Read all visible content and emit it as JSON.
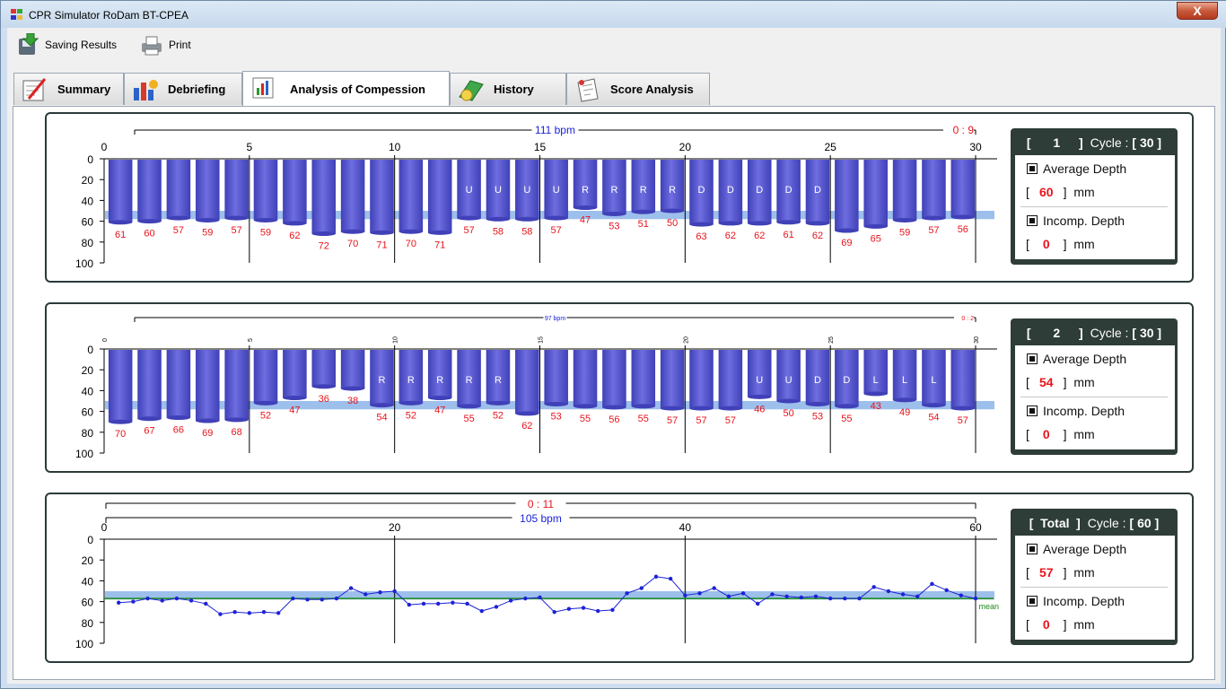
{
  "window": {
    "title": "CPR Simulator RoDam BT-CPEA",
    "close_label": "X"
  },
  "toolbar": {
    "save_label": "Saving Results",
    "print_label": "Print"
  },
  "tabs": [
    {
      "label": "Summary",
      "icon": "summary-icon"
    },
    {
      "label": "Debriefing",
      "icon": "debriefing-icon"
    },
    {
      "label": "Analysis of Compession",
      "icon": "bar-chart-icon",
      "active": true
    },
    {
      "label": "History",
      "icon": "history-icon"
    },
    {
      "label": "Score Analysis",
      "icon": "score-icon"
    }
  ],
  "colors": {
    "bar": "#6e6ee0",
    "bar_dark": "#4040b8",
    "band": "#8cb4e8",
    "value_text": "#e8141c",
    "bpm_text": "#1c22d6",
    "mean_line": "#1a8a1a"
  },
  "chart_data": [
    {
      "type": "bar",
      "title": "111 bpm",
      "time_label": "0 : 9",
      "x_ticks": [
        "0",
        "5",
        "10",
        "15",
        "20",
        "25",
        "30"
      ],
      "y_ticks": [
        "0",
        "20",
        "40",
        "60",
        "80",
        "100"
      ],
      "ylim": [
        0,
        100
      ],
      "target_band": [
        50,
        58
      ],
      "values": [
        61,
        60,
        57,
        59,
        57,
        59,
        62,
        72,
        70,
        71,
        70,
        71,
        57,
        58,
        58,
        57,
        47,
        53,
        51,
        50,
        63,
        62,
        62,
        61,
        62,
        69,
        65,
        59,
        57,
        56
      ],
      "labels": [
        "",
        "",
        "",
        "",
        "",
        "",
        "",
        "",
        "",
        "",
        "",
        "",
        "U",
        "U",
        "U",
        "U",
        "R",
        "R",
        "R",
        "R",
        "D",
        "D",
        "D",
        "D",
        "D",
        "",
        "",
        "",
        "",
        ""
      ]
    },
    {
      "type": "bar",
      "title": "97 bpm",
      "time_label": "0 : 2",
      "x_ticks": [
        "0",
        "5",
        "10",
        "15",
        "20",
        "25",
        "30"
      ],
      "y_ticks": [
        "0",
        "20",
        "40",
        "60",
        "80",
        "100"
      ],
      "ylim": [
        0,
        100
      ],
      "target_band": [
        50,
        58
      ],
      "values": [
        70,
        67,
        66,
        69,
        68,
        52,
        47,
        36,
        38,
        54,
        52,
        47,
        55,
        52,
        62,
        53,
        55,
        56,
        55,
        57,
        57,
        57,
        46,
        50,
        53,
        55,
        43,
        49,
        54,
        57
      ],
      "labels": [
        "",
        "",
        "",
        "",
        "",
        "",
        "",
        "",
        "",
        "R",
        "R",
        "R",
        "R",
        "R",
        "",
        "",
        "",
        "",
        "",
        "",
        "",
        "",
        "U",
        "U",
        "D",
        "D",
        "L",
        "L",
        "L",
        ""
      ]
    },
    {
      "type": "line",
      "title": "105 bpm",
      "time_label": "0 : 11",
      "mean_label": "mean",
      "x_ticks": [
        "0",
        "20",
        "40",
        "60"
      ],
      "y_ticks": [
        "0",
        "20",
        "40",
        "60",
        "80",
        "100"
      ],
      "ylim": [
        0,
        100
      ],
      "target_band": [
        50,
        58
      ],
      "mean": 57,
      "values": [
        61,
        60,
        57,
        59,
        57,
        59,
        62,
        72,
        70,
        71,
        70,
        71,
        57,
        58,
        58,
        57,
        47,
        53,
        51,
        50,
        63,
        62,
        62,
        61,
        62,
        69,
        65,
        59,
        57,
        56,
        70,
        67,
        66,
        69,
        68,
        52,
        47,
        36,
        38,
        54,
        52,
        47,
        55,
        52,
        62,
        53,
        55,
        56,
        55,
        57,
        57,
        57,
        46,
        50,
        53,
        55,
        43,
        49,
        54,
        57
      ]
    }
  ],
  "panels": [
    {
      "cycle_no": "1",
      "cycle_label": "Cycle :",
      "cycle_total": "30",
      "avg_label": "Average Depth",
      "avg_value": "60",
      "incomp_label": "Incomp. Depth",
      "incomp_value": "0",
      "unit": "mm"
    },
    {
      "cycle_no": "2",
      "cycle_label": "Cycle :",
      "cycle_total": "30",
      "avg_label": "Average Depth",
      "avg_value": "54",
      "incomp_label": "Incomp. Depth",
      "incomp_value": "0",
      "unit": "mm"
    },
    {
      "cycle_no": "Total",
      "cycle_label": "Cycle :",
      "cycle_total": "60",
      "avg_label": "Average Depth",
      "avg_value": "57",
      "incomp_label": "Incomp. Depth",
      "incomp_value": "0",
      "unit": "mm"
    }
  ]
}
